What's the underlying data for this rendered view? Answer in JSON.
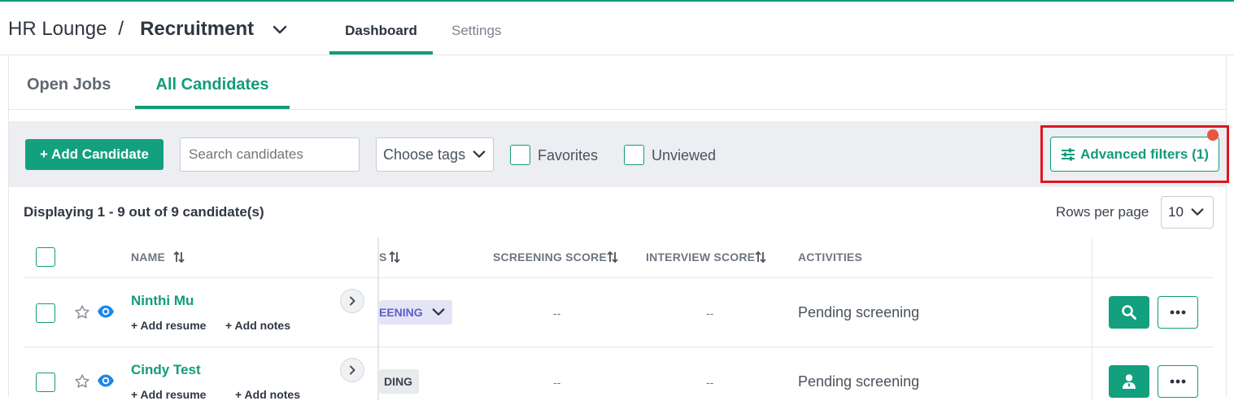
{
  "header": {
    "workspace": "HR Lounge",
    "separator": "/",
    "section": "Recruitment",
    "tabs": [
      {
        "label": "Dashboard",
        "active": true
      },
      {
        "label": "Settings",
        "active": false
      }
    ]
  },
  "subtabs": [
    {
      "label": "Open Jobs",
      "active": false
    },
    {
      "label": "All Candidates",
      "active": true
    }
  ],
  "toolbar": {
    "add_candidate_label": "+ Add Candidate",
    "search_placeholder": "Search candidates",
    "tags_label": "Choose tags",
    "favorites_label": "Favorites",
    "unviewed_label": "Unviewed",
    "advanced_filters_label": "Advanced filters (1)"
  },
  "list": {
    "display_count": "Displaying 1 - 9 out of 9 candidate(s)",
    "rows_per_page_label": "Rows per page",
    "rows_per_page_value": "10",
    "columns": {
      "name": "NAME",
      "status_partial": "S",
      "screening_score": "SCREENING SCORE",
      "interview_score": "INTERVIEW SCORE",
      "activities": "ACTIVITIES"
    },
    "rows": [
      {
        "name": "Ninthi Mu",
        "add_resume": "+ Add resume",
        "add_notes": "+ Add notes",
        "status_partial": "EENING",
        "screening_score": "--",
        "interview_score": "--",
        "activity": "Pending screening"
      },
      {
        "name": "Cindy Test",
        "add_resume": "+ Add resume",
        "add_notes": "+ Add notes",
        "status_partial": "DING",
        "screening_score": "--",
        "interview_score": "--",
        "activity": "Pending screening"
      }
    ]
  },
  "colors": {
    "brand_green": "#139b7a",
    "highlight_red": "#e0161e",
    "notification_dot": "#e9553f",
    "status_purple_bg": "#e4e4f7",
    "status_purple_text": "#5b5fc7"
  }
}
